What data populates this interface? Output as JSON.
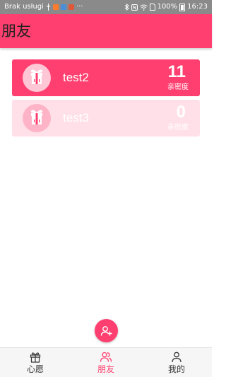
{
  "status_bar": {
    "carrier": "Brak usługi",
    "more": "···",
    "battery_percent": "100%",
    "time": "16:23",
    "icons": [
      "usb-icon",
      "app-icon-orange",
      "app-icon-blue",
      "app-icon-red",
      "bluetooth-icon",
      "nfc-icon",
      "wifi-icon",
      "sim-icon",
      "battery-icon"
    ]
  },
  "header": {
    "title": "朋友"
  },
  "friends": [
    {
      "name": "test2",
      "intimacy_value": "11",
      "intimacy_label": "亲密度",
      "avatar_icon": "gift-icon",
      "background": "#ff3f6f",
      "text_color": "#ffffff"
    },
    {
      "name": "test3",
      "intimacy_value": "0",
      "intimacy_label": "亲密度",
      "avatar_icon": "gift-icon",
      "background": "#ffe0e8",
      "text_color": "#ffffff"
    }
  ],
  "fab": {
    "icon": "add-friend-icon"
  },
  "bottom_nav": {
    "active_color": "#ff3f6f",
    "inactive_color": "#333333",
    "items": [
      {
        "label": "心愿",
        "icon": "gift-icon",
        "active": false
      },
      {
        "label": "朋友",
        "icon": "friends-icon",
        "active": true
      },
      {
        "label": "我的",
        "icon": "person-icon",
        "active": false
      }
    ]
  },
  "colors": {
    "accent": "#ff3f6f",
    "card_inactive": "#ffe0e8",
    "status_bar": "#8a8a8a"
  }
}
